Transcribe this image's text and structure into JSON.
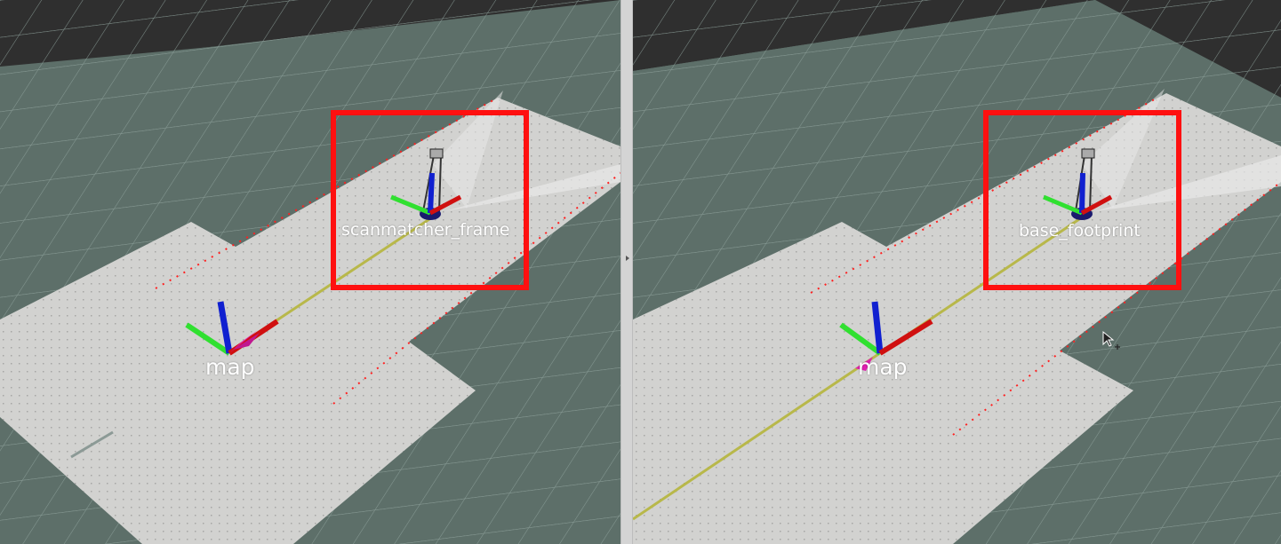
{
  "left_view": {
    "tracked_frame_label": "scanmatcher_frame",
    "map_label": "map"
  },
  "right_view": {
    "tracked_frame_label": "base_footprint",
    "map_label": "map"
  },
  "colors": {
    "grid_background": "#5d6f69",
    "occupancy_map": "#d2d2d0",
    "highlight": "#ff1010",
    "x_axis": "#d01010",
    "y_axis": "#30e030",
    "z_axis": "#1020d0",
    "path": "#b8b84a"
  },
  "icons": {
    "splitter": "chevron-right-icon",
    "cursor": "mouse-pointer-icon"
  }
}
